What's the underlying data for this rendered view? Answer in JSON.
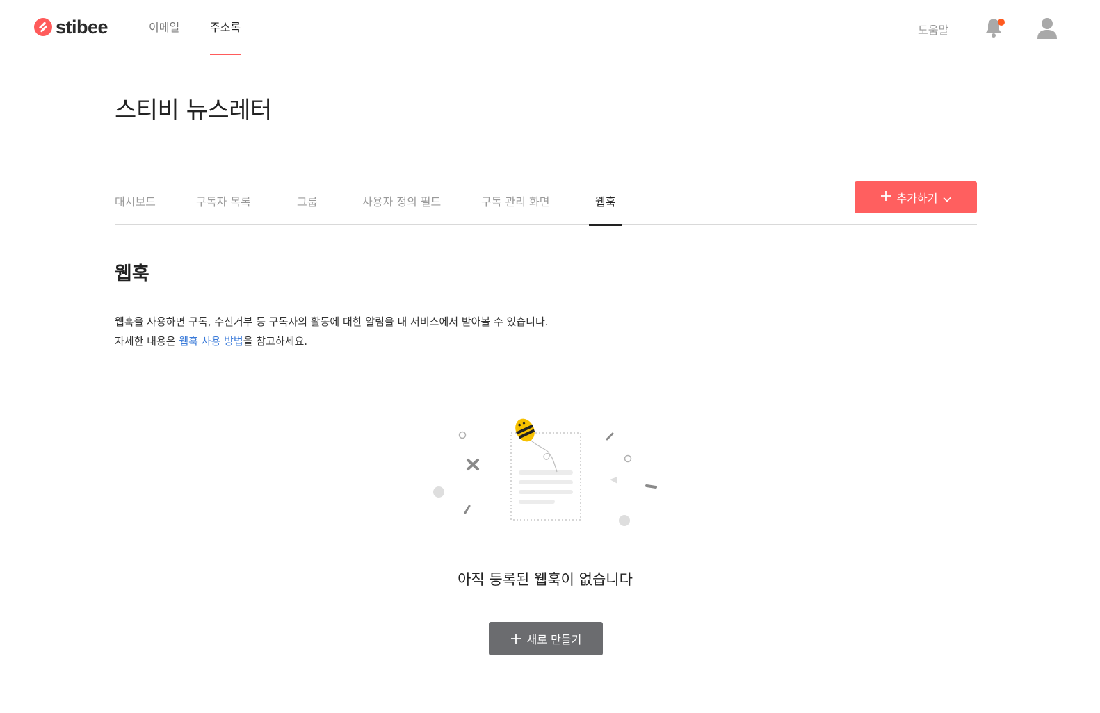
{
  "brand": {
    "name": "stibee",
    "accent": "#ff5b5b"
  },
  "topnav": {
    "items": [
      {
        "label": "이메일",
        "active": false
      },
      {
        "label": "주소록",
        "active": true
      }
    ],
    "help": "도움말"
  },
  "page": {
    "title": "스티비 뉴스레터"
  },
  "tabs": [
    {
      "label": "대시보드"
    },
    {
      "label": "구독자 목록"
    },
    {
      "label": "그룹"
    },
    {
      "label": "사용자 정의 필드"
    },
    {
      "label": "구독 관리 화면"
    },
    {
      "label": "웹훅",
      "active": true
    }
  ],
  "add_button": {
    "label": "추가하기"
  },
  "section": {
    "title": "웹훅",
    "desc_line1": "웹훅을 사용하면 구독, 수신거부 등 구독자의 활동에 대한 알림을 내 서비스에서 받아볼 수 있습니다.",
    "desc_line2_prefix": "자세한 내용은 ",
    "desc_link": "웹훅 사용 방법",
    "desc_line2_suffix": "을 참고하세요."
  },
  "empty": {
    "message": "아직 등록된 웹훅이 없습니다",
    "button": "새로 만들기"
  },
  "icons": {
    "bell": "bell-icon",
    "user": "user-icon",
    "plus": "plus-icon",
    "chevron": "chevron-down-icon"
  },
  "colors": {
    "primary_button": "#ff5f5f",
    "secondary_button": "#6b6c6f",
    "link": "#3b7bd9",
    "notification_dot": "#ff5a1f"
  }
}
